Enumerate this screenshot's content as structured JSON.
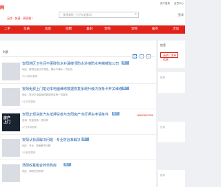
{
  "header": {
    "logo_text": "网",
    "slogan": "无忧 · 快速 · 高质量！",
    "search_placeholder": "快速查找（工作/关键字）",
    "top_links": [
      "用户登录",
      "会员中心"
    ],
    "login_text": "登录"
  },
  "nav": {
    "items": [
      "二手",
      "车辆",
      "房屋",
      "招聘",
      "兼职",
      "宠物",
      "交友/导人",
      "宠物",
      "服务",
      "活动"
    ]
  },
  "main": {
    "list_title": "列表",
    "listings": [
      {
        "title": "安阳地区卫生间不砸砖防水补漏楼顶防水外墙防水电梯楼监公司",
        "badge": "推广",
        "sub": "地区 · 楼顶全面诊疗调查，漏水不漏水一次到位",
        "meta": "15 分钟前更新",
        "phone": "",
        "has_ad_thumb": false,
        "thumb_text": ""
      },
      {
        "title": "安阳免费上门笔记本电脑维修数据恢复系统升级内存条卡开关维修",
        "badge": "推广",
        "sub": "地区 · 笔记本电脑维修数据恢复等一切服务",
        "meta": "1小时前更新",
        "phone": "",
        "has_ad_thumb": false,
        "thumb_text": ""
      },
      {
        "title": "安阳正规贷款汽车抵押贷款与安阳房产当行押车申请条件",
        "badge": "推广",
        "sub": "信用 · 快速放款 · 低利率",
        "meta": "17分钟前更新",
        "phone": "18600843789",
        "has_ad_thumb": true,
        "thumb_text": "房产\n上门"
      },
      {
        "title": "安阳认标源解决问题 · 专业防治准解决",
        "badge": "推广",
        "sub": "地区 · 专业 · 快速解决问题",
        "meta": "1分钟前更新",
        "phone": "",
        "has_ad_thumb": false,
        "thumb_text": ""
      },
      {
        "title": "汤阴收蓄箱台转单购房",
        "badge": "推广",
        "sub": "地区 · 源码在线购房",
        "meta": "",
        "phone": "",
        "has_ad_thumb": false,
        "thumb_text": ""
      }
    ]
  },
  "sidebar": {
    "title": "信息",
    "button": "汤阴 · 发布信息",
    "links": [
      "推荐",
      "信息",
      "推荐"
    ]
  },
  "colors": {
    "brand_red": "#e2231a",
    "link_blue": "#1f5fa8"
  }
}
